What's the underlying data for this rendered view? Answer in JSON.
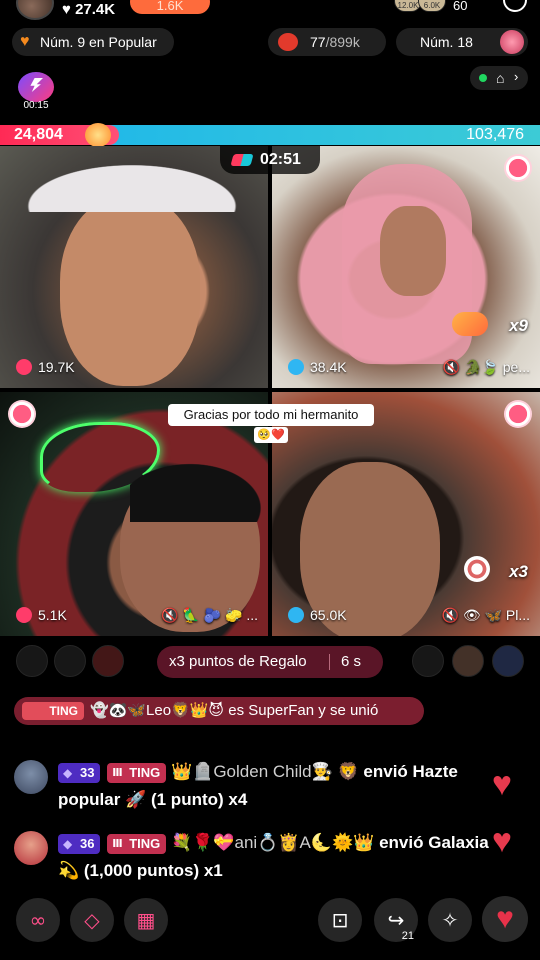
{
  "top": {
    "likes": "27.4K",
    "follow_count": "1.6K",
    "viewer_badges": [
      "12.0K",
      "6.0K"
    ],
    "viewer_count": "60"
  },
  "ranking": {
    "popular_label": "Núm. 9 en Popular",
    "points_current": "77",
    "points_total": "/899k",
    "rank_label": "Núm. 18"
  },
  "live_badge": {
    "time": "00:15"
  },
  "battle": {
    "left_score": "24,804",
    "right_score": "103,476",
    "left_share": 0.19,
    "timer": "02:51"
  },
  "tiles": [
    {
      "viewers": "19.7K",
      "mute": ""
    },
    {
      "viewers": "38.4K",
      "mute": "🔇 🐊🍃 pe...",
      "multiplier": "x9"
    },
    {
      "viewers": "5.1K",
      "mute": "🔇 🦜 🫐 🧽 ..."
    },
    {
      "viewers": "65.0K",
      "mute": "🔇 👁 🦋 Pl...",
      "multiplier": "x3"
    }
  ],
  "caption": {
    "text": "Gracias por todo mi hermanito",
    "emoji": "🥺❤️"
  },
  "gift_banner": {
    "label": "x3 puntos de Regalo",
    "seconds": "6 s"
  },
  "join_banner": {
    "level": "TING",
    "emojis": "👻🐼🦋",
    "name": "Leo🦁👑😈",
    "text": " es SuperFan y se unió"
  },
  "comments": [
    {
      "level": "33",
      "tag": "TING",
      "name": "👑🪦Golden Child👨‍🍳 🦁",
      "action": " envió Hazte popular",
      "detail": "🚀 (1 punto) x4"
    },
    {
      "level": "36",
      "tag": "TING",
      "name": "💐🌹💝ani💍👸A🌜🌞👑",
      "action": " envió Galaxia",
      "detail": "💫 (1,000 puntos) x1"
    }
  ],
  "bottom": {
    "share_count": "21"
  },
  "colors": {
    "battle_left": "#ff2a55",
    "battle_right": "#1bb5ec",
    "banner": "#5a1527"
  }
}
